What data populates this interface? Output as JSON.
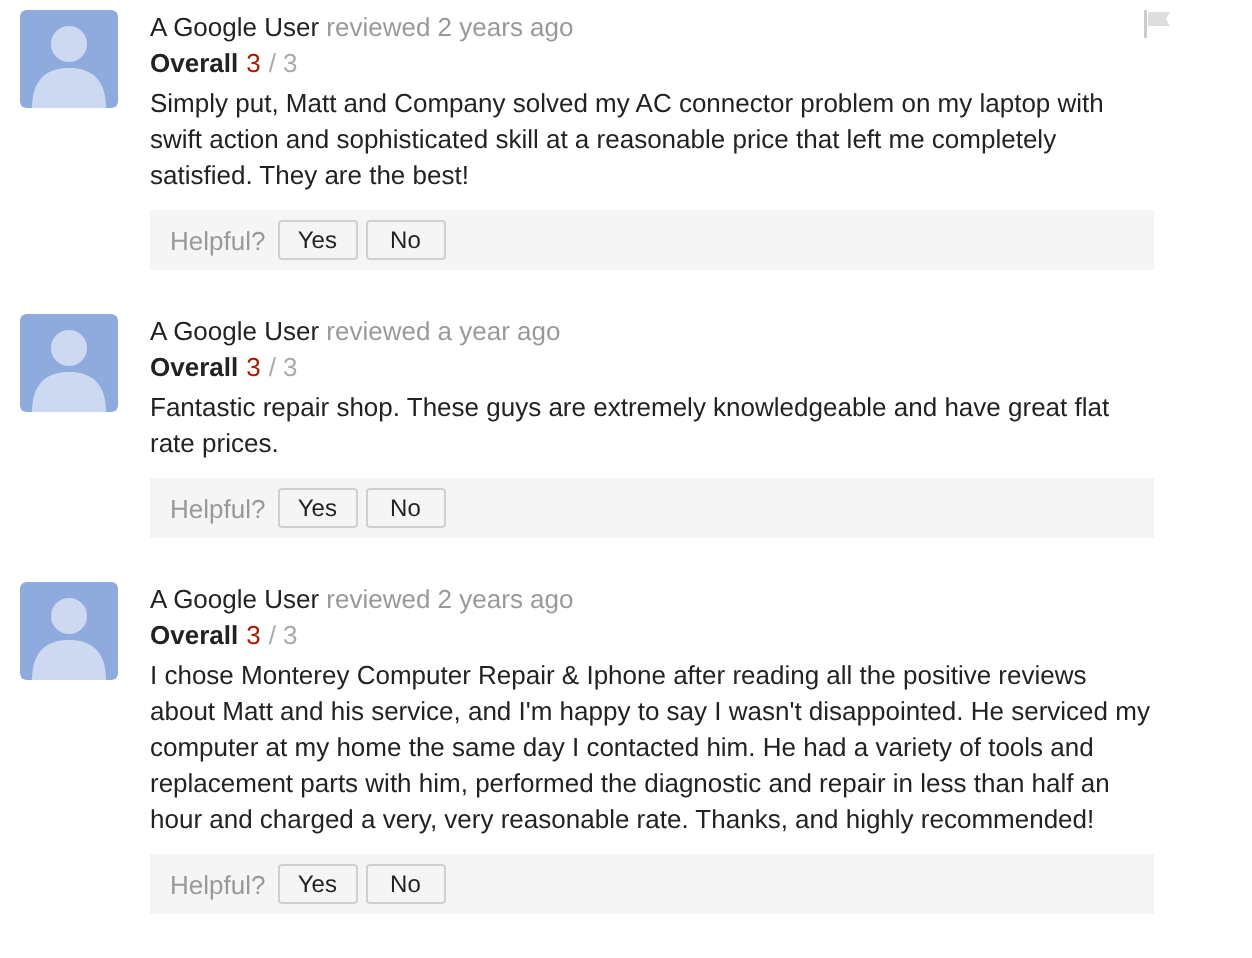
{
  "reviews": [
    {
      "author": "A Google User",
      "when": "reviewed 2 years ago",
      "rating_label": "Overall",
      "score": "3",
      "max": "/ 3",
      "text": "Simply put, Matt and Company solved my AC connector problem on my laptop with swift action and sophisticated skill at a reasonable price that left me completely satisfied. They are the best!",
      "flag": true,
      "helpful": {
        "label": "Helpful?",
        "yes": "Yes",
        "no": "No"
      }
    },
    {
      "author": "A Google User",
      "when": "reviewed a year ago",
      "rating_label": "Overall",
      "score": "3",
      "max": "/ 3",
      "text": "Fantastic repair shop. These guys are extremely knowledgeable and have great flat rate prices.",
      "flag": false,
      "helpful": {
        "label": "Helpful?",
        "yes": "Yes",
        "no": "No"
      }
    },
    {
      "author": "A Google User",
      "when": "reviewed 2 years ago",
      "rating_label": "Overall",
      "score": "3",
      "max": "/ 3",
      "text": "I chose Monterey Computer Repair & Iphone after reading all the positive reviews about Matt and his service, and I'm happy to say I wasn't disappointed. He serviced my computer at my home the same day I contacted him. He had a variety of tools and replacement parts with him, performed the diagnostic and repair in less than half an hour and charged a very, very reasonable rate. Thanks, and highly recommended!",
      "flag": false,
      "helpful": {
        "label": "Helpful?",
        "yes": "Yes",
        "no": "No"
      }
    }
  ]
}
